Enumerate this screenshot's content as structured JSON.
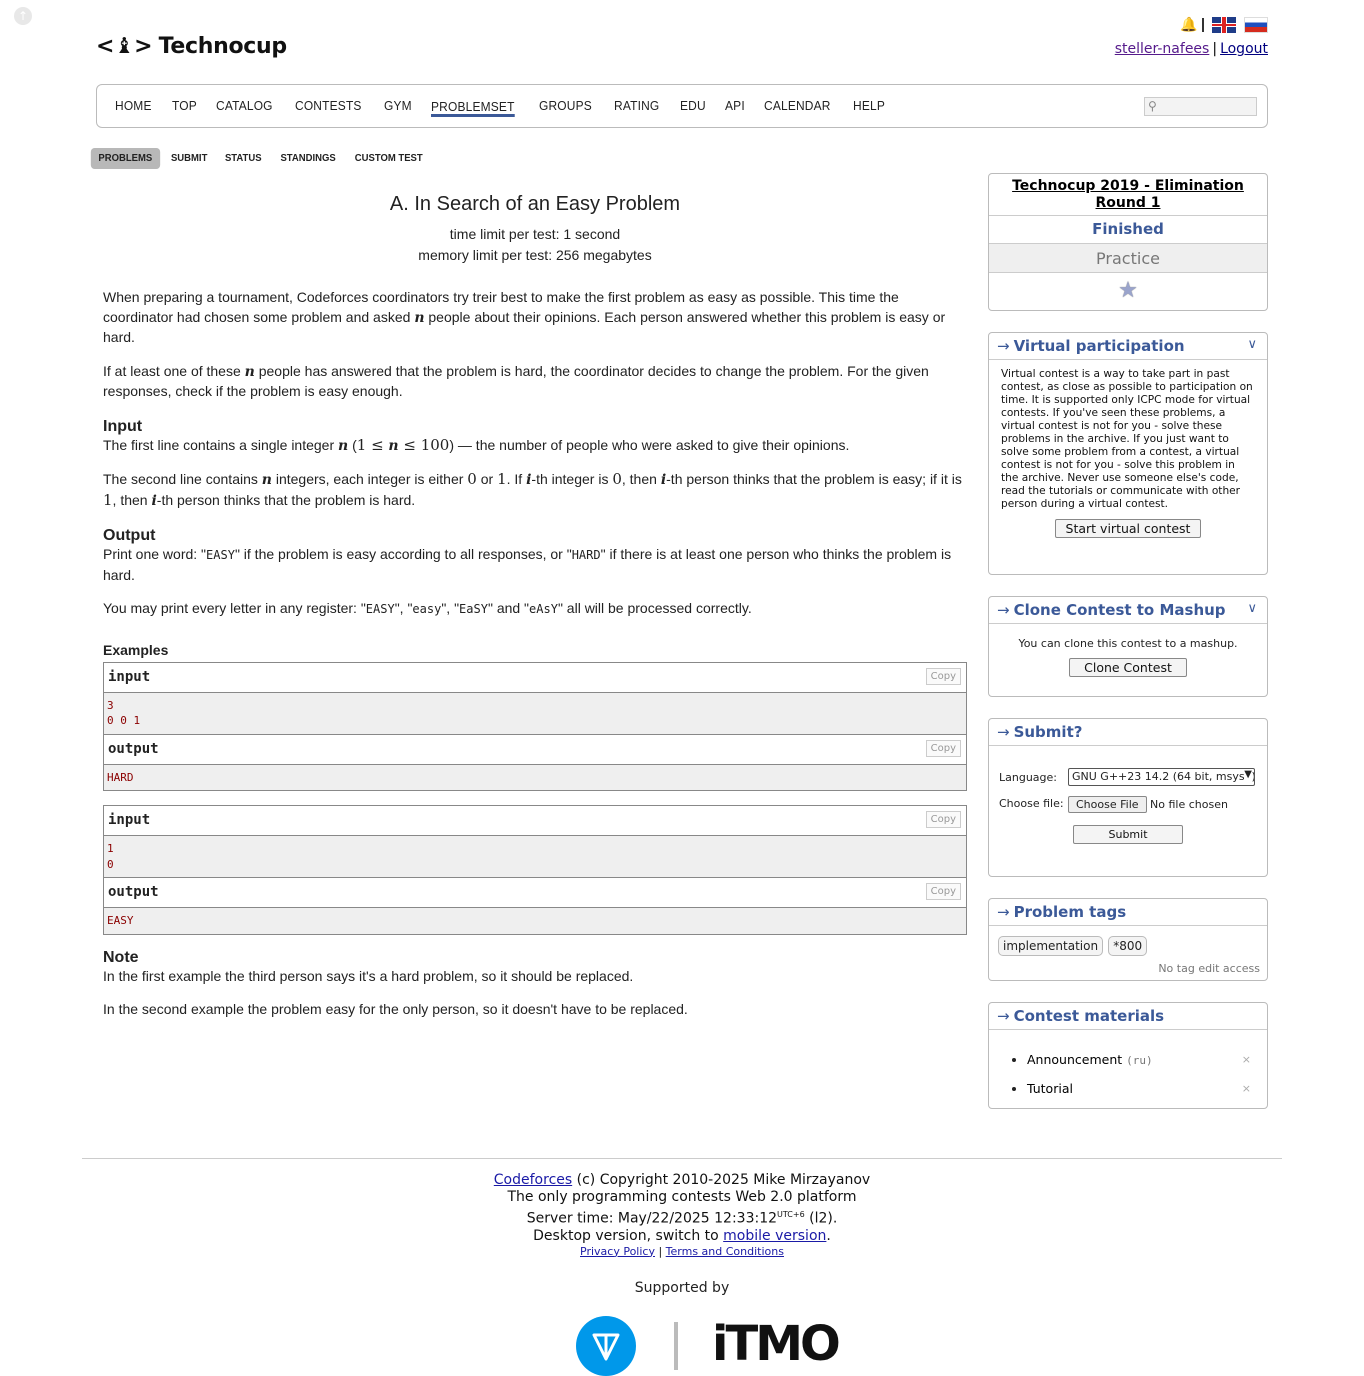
{
  "header": {
    "logo_mark": "<♝>",
    "logo_text": "Technocup",
    "username": "steller-nafees",
    "logout": "Logout",
    "separator": "|"
  },
  "menu": {
    "items": [
      "HOME",
      "TOP",
      "CATALOG",
      "CONTESTS",
      "GYM",
      "PROBLEMSET",
      "GROUPS",
      "RATING",
      "EDU",
      "API",
      "CALENDAR",
      "HELP"
    ],
    "active": "PROBLEMSET"
  },
  "submenu": {
    "items": [
      "PROBLEMS",
      "SUBMIT",
      "STATUS",
      "STANDINGS",
      "CUSTOM TEST"
    ]
  },
  "problem": {
    "title": "A. In Search of an Easy Problem",
    "time_limit": "time limit per test: 1 second",
    "memory_limit": "memory limit per test: 256 megabytes",
    "statement_1a": "When preparing a tournament, Codeforces coordinators try treir best to make the first problem as easy as possible. This time the coordinator had chosen some problem and asked ",
    "statement_1b": " people about their opinions. Each person answered whether this problem is easy or hard.",
    "statement_2a": "If at least one of these ",
    "statement_2b": " people has answered that the problem is hard, the coordinator decides to change the problem. For the given responses, check if the problem is easy enough.",
    "var_n": "n",
    "var_i": "i",
    "input_head": "Input",
    "input_1a": "The first line contains a single integer ",
    "input_1_math_open": " (",
    "input_1_math": "1 ≤ ",
    "input_1_math_end": " ≤ 100",
    "input_1b": ") — the number of people who were asked to give their opinions.",
    "input_2a": "The second line contains ",
    "input_2b": " integers, each integer is either ",
    "zero": "0",
    "one": "1",
    "input_2c": " or ",
    "input_2d": ". If ",
    "input_2e": "-th integer is ",
    "input_2f": ", then ",
    "input_2g": "-th person thinks that the problem is easy; if it is ",
    "input_2h": ", then ",
    "input_2i": "-th person thinks that the problem is hard.",
    "output_head": "Output",
    "output_1a": "Print one word: \"",
    "easy_word": "EASY",
    "output_1b": "\" if the problem is easy according to all responses, or \"",
    "hard_word": "HARD",
    "output_1c": "\" if there is at least one person who thinks the problem is hard.",
    "output_2a": "You may print every letter in any register: \"",
    "reg_1": "EASY",
    "reg_sep": "\", \"",
    "reg_2": "easy",
    "reg_3": "EaSY",
    "reg_and": "\" and \"",
    "reg_4": "eAsY",
    "output_2b": "\" all will be processed correctly.",
    "examples_head": "Examples",
    "examples": [
      {
        "input_label": "input",
        "input_data": "3\n0 0 1",
        "output_label": "output",
        "output_data": "HARD"
      },
      {
        "input_label": "input",
        "input_data": "1\n0",
        "output_label": "output",
        "output_data": "EASY"
      }
    ],
    "copy_label": "Copy",
    "note_head": "Note",
    "note_1": "In the first example the third person says it's a hard problem, so it should be replaced.",
    "note_2": "In the second example the problem easy for the only person, so it doesn't have to be replaced."
  },
  "sidebar": {
    "contest_name": "Technocup 2019 - Elimination Round 1",
    "status": "Finished",
    "mode": "Practice",
    "virtual": {
      "title": "Virtual participation",
      "text": "Virtual contest is a way to take part in past contest, as close as possible to participation on time. It is supported only ICPC mode for virtual contests. If you've seen these problems, a virtual contest is not for you - solve these problems in the archive. If you just want to solve some problem from a contest, a virtual contest is not for you - solve this problem in the archive. Never use someone else's code, read the tutorials or communicate with other person during a virtual contest.",
      "button": "Start virtual contest"
    },
    "clone": {
      "title": "Clone Contest to Mashup",
      "text": "You can clone this contest to a mashup.",
      "button": "Clone Contest"
    },
    "submit": {
      "title": "Submit?",
      "language_label": "Language:",
      "language_value": "GNU G++23 14.2 (64 bit, msys2)",
      "file_label": "Choose file:",
      "file_button": "Choose File",
      "file_status": "No file chosen",
      "button": "Submit"
    },
    "tags": {
      "title": "Problem tags",
      "items": [
        "implementation",
        "*800"
      ],
      "note": "No tag edit access"
    },
    "materials": {
      "title": "Contest materials",
      "items": [
        "Announcement",
        "Tutorial"
      ],
      "announcement_lang": "(ru)"
    },
    "arrow": "→",
    "close_mark": "×"
  },
  "footer": {
    "codeforces": "Codeforces",
    "copyright": " (c) Copyright 2010-2025 Mike Mirzayanov",
    "platform": "The only programming contests Web 2.0 platform",
    "server_time": "Server time: May/22/2025 12:33:12",
    "utc": "UTC+6",
    "server_suffix": " (l2).",
    "desktop": "Desktop version, switch to ",
    "mobile": "mobile version",
    "period": ".",
    "privacy": "Privacy Policy",
    "terms": "Terms and Conditions",
    "supported": "Supported by",
    "itmo": "iTMO"
  }
}
